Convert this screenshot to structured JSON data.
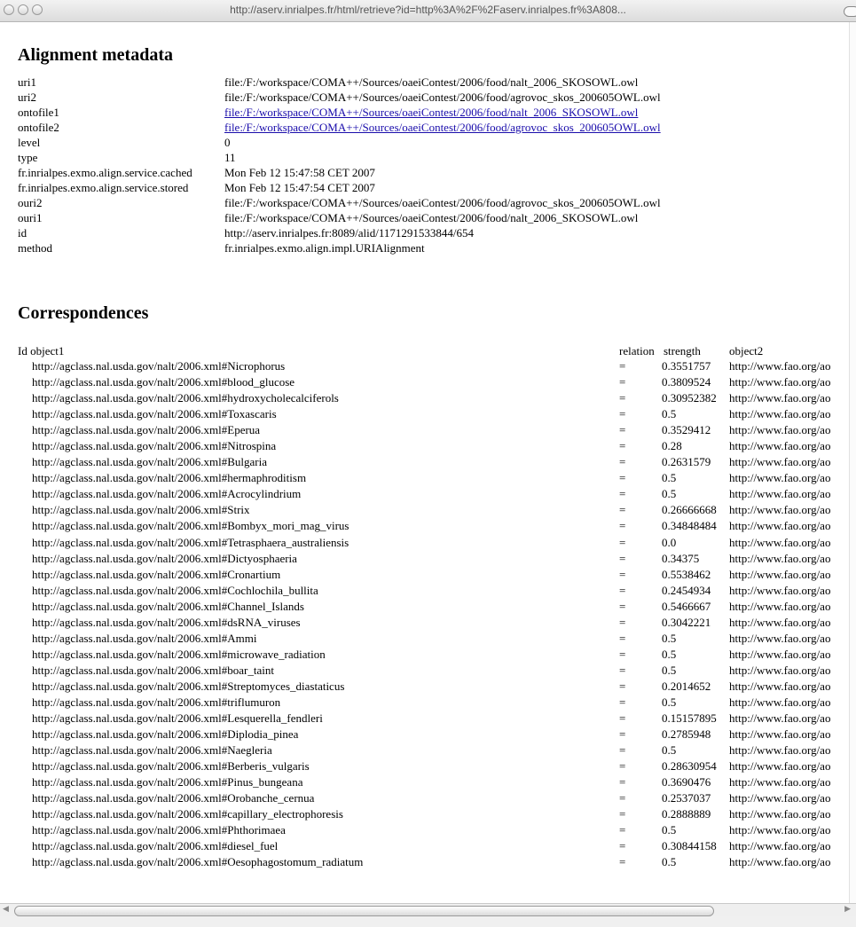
{
  "window": {
    "url": "http://aserv.inrialpes.fr/html/retrieve?id=http%3A%2F%2Faserv.inrialpes.fr%3A808..."
  },
  "metadata": {
    "heading": "Alignment metadata",
    "rows": [
      {
        "key": "uri1",
        "value": "file:/F:/workspace/COMA++/Sources/oaeiContest/2006/food/nalt_2006_SKOSOWL.owl"
      },
      {
        "key": "uri2",
        "value": "file:/F:/workspace/COMA++/Sources/oaeiContest/2006/food/agrovoc_skos_200605OWL.owl"
      },
      {
        "key": "ontofile1",
        "value": "file:/F:/workspace/COMA++/Sources/oaeiContest/2006/food/nalt_2006_SKOSOWL.owl"
      },
      {
        "key": "ontofile2",
        "value": "file:/F:/workspace/COMA++/Sources/oaeiContest/2006/food/agrovoc_skos_200605OWL.owl"
      },
      {
        "key": "level",
        "value": "0"
      },
      {
        "key": "type",
        "value": "11"
      },
      {
        "key": "fr.inrialpes.exmo.align.service.cached",
        "value": "Mon Feb 12 15:47:58 CET 2007"
      },
      {
        "key": "fr.inrialpes.exmo.align.service.stored",
        "value": "Mon Feb 12 15:47:54 CET 2007"
      },
      {
        "key": "ouri2",
        "value": "file:/F:/workspace/COMA++/Sources/oaeiContest/2006/food/agrovoc_skos_200605OWL.owl"
      },
      {
        "key": "ouri1",
        "value": "file:/F:/workspace/COMA++/Sources/oaeiContest/2006/food/nalt_2006_SKOSOWL.owl"
      },
      {
        "key": "id",
        "value": "http://aserv.inrialpes.fr:8089/alid/1171291533844/654"
      },
      {
        "key": "method",
        "value": "fr.inrialpes.exmo.align.impl.URIAlignment"
      }
    ]
  },
  "correspondences": {
    "heading": "Correspondences",
    "headers": {
      "id_object1": "Id object1",
      "relation": "relation",
      "strength": "strength",
      "object2": "object2"
    },
    "rows": [
      {
        "object1": "http://agclass.nal.usda.gov/nalt/2006.xml#Nicrophorus",
        "relation": "=",
        "strength": "0.3551757",
        "object2": "http://www.fao.org/ao"
      },
      {
        "object1": "http://agclass.nal.usda.gov/nalt/2006.xml#blood_glucose",
        "relation": "=",
        "strength": "0.3809524",
        "object2": "http://www.fao.org/ao"
      },
      {
        "object1": "http://agclass.nal.usda.gov/nalt/2006.xml#hydroxycholecalciferols",
        "relation": "=",
        "strength": "0.30952382",
        "object2": "http://www.fao.org/ao"
      },
      {
        "object1": "http://agclass.nal.usda.gov/nalt/2006.xml#Toxascaris",
        "relation": "=",
        "strength": "0.5",
        "object2": "http://www.fao.org/ao"
      },
      {
        "object1": "http://agclass.nal.usda.gov/nalt/2006.xml#Eperua",
        "relation": "=",
        "strength": "0.3529412",
        "object2": "http://www.fao.org/ao"
      },
      {
        "object1": "http://agclass.nal.usda.gov/nalt/2006.xml#Nitrospina",
        "relation": "=",
        "strength": "0.28",
        "object2": "http://www.fao.org/ao"
      },
      {
        "object1": "http://agclass.nal.usda.gov/nalt/2006.xml#Bulgaria",
        "relation": "=",
        "strength": "0.2631579",
        "object2": "http://www.fao.org/ao"
      },
      {
        "object1": "http://agclass.nal.usda.gov/nalt/2006.xml#hermaphroditism",
        "relation": "=",
        "strength": "0.5",
        "object2": "http://www.fao.org/ao"
      },
      {
        "object1": "http://agclass.nal.usda.gov/nalt/2006.xml#Acrocylindrium",
        "relation": "=",
        "strength": "0.5",
        "object2": "http://www.fao.org/ao"
      },
      {
        "object1": "http://agclass.nal.usda.gov/nalt/2006.xml#Strix",
        "relation": "=",
        "strength": "0.26666668",
        "object2": "http://www.fao.org/ao"
      },
      {
        "object1": "http://agclass.nal.usda.gov/nalt/2006.xml#Bombyx_mori_mag_virus",
        "relation": "=",
        "strength": "0.34848484",
        "object2": "http://www.fao.org/ao"
      },
      {
        "object1": "http://agclass.nal.usda.gov/nalt/2006.xml#Tetrasphaera_australiensis",
        "relation": "=",
        "strength": "0.0",
        "object2": "http://www.fao.org/ao"
      },
      {
        "object1": "http://agclass.nal.usda.gov/nalt/2006.xml#Dictyosphaeria",
        "relation": "=",
        "strength": "0.34375",
        "object2": "http://www.fao.org/ao"
      },
      {
        "object1": "http://agclass.nal.usda.gov/nalt/2006.xml#Cronartium",
        "relation": "=",
        "strength": "0.5538462",
        "object2": "http://www.fao.org/ao"
      },
      {
        "object1": "http://agclass.nal.usda.gov/nalt/2006.xml#Cochlochila_bullita",
        "relation": "=",
        "strength": "0.2454934",
        "object2": "http://www.fao.org/ao"
      },
      {
        "object1": "http://agclass.nal.usda.gov/nalt/2006.xml#Channel_Islands",
        "relation": "=",
        "strength": "0.5466667",
        "object2": "http://www.fao.org/ao"
      },
      {
        "object1": "http://agclass.nal.usda.gov/nalt/2006.xml#dsRNA_viruses",
        "relation": "=",
        "strength": "0.3042221",
        "object2": "http://www.fao.org/ao"
      },
      {
        "object1": "http://agclass.nal.usda.gov/nalt/2006.xml#Ammi",
        "relation": "=",
        "strength": "0.5",
        "object2": "http://www.fao.org/ao"
      },
      {
        "object1": "http://agclass.nal.usda.gov/nalt/2006.xml#microwave_radiation",
        "relation": "=",
        "strength": "0.5",
        "object2": "http://www.fao.org/ao"
      },
      {
        "object1": "http://agclass.nal.usda.gov/nalt/2006.xml#boar_taint",
        "relation": "=",
        "strength": "0.5",
        "object2": "http://www.fao.org/ao"
      },
      {
        "object1": "http://agclass.nal.usda.gov/nalt/2006.xml#Streptomyces_diastaticus",
        "relation": "=",
        "strength": "0.2014652",
        "object2": "http://www.fao.org/ao"
      },
      {
        "object1": "http://agclass.nal.usda.gov/nalt/2006.xml#triflumuron",
        "relation": "=",
        "strength": "0.5",
        "object2": "http://www.fao.org/ao"
      },
      {
        "object1": "http://agclass.nal.usda.gov/nalt/2006.xml#Lesquerella_fendleri",
        "relation": "=",
        "strength": "0.15157895",
        "object2": "http://www.fao.org/ao"
      },
      {
        "object1": "http://agclass.nal.usda.gov/nalt/2006.xml#Diplodia_pinea",
        "relation": "=",
        "strength": "0.2785948",
        "object2": "http://www.fao.org/ao"
      },
      {
        "object1": "http://agclass.nal.usda.gov/nalt/2006.xml#Naegleria",
        "relation": "=",
        "strength": "0.5",
        "object2": "http://www.fao.org/ao"
      },
      {
        "object1": "http://agclass.nal.usda.gov/nalt/2006.xml#Berberis_vulgaris",
        "relation": "=",
        "strength": "0.28630954",
        "object2": "http://www.fao.org/ao"
      },
      {
        "object1": "http://agclass.nal.usda.gov/nalt/2006.xml#Pinus_bungeana",
        "relation": "=",
        "strength": "0.3690476",
        "object2": "http://www.fao.org/ao"
      },
      {
        "object1": "http://agclass.nal.usda.gov/nalt/2006.xml#Orobanche_cernua",
        "relation": "=",
        "strength": "0.2537037",
        "object2": "http://www.fao.org/ao"
      },
      {
        "object1": "http://agclass.nal.usda.gov/nalt/2006.xml#capillary_electrophoresis",
        "relation": "=",
        "strength": "0.2888889",
        "object2": "http://www.fao.org/ao"
      },
      {
        "object1": "http://agclass.nal.usda.gov/nalt/2006.xml#Phthorimaea",
        "relation": "=",
        "strength": "0.5",
        "object2": "http://www.fao.org/ao"
      },
      {
        "object1": "http://agclass.nal.usda.gov/nalt/2006.xml#diesel_fuel",
        "relation": "=",
        "strength": "0.30844158",
        "object2": "http://www.fao.org/ao"
      },
      {
        "object1": "http://agclass.nal.usda.gov/nalt/2006.xml#Oesophagostomum_radiatum",
        "relation": "=",
        "strength": "0.5",
        "object2": "http://www.fao.org/ao"
      }
    ]
  }
}
